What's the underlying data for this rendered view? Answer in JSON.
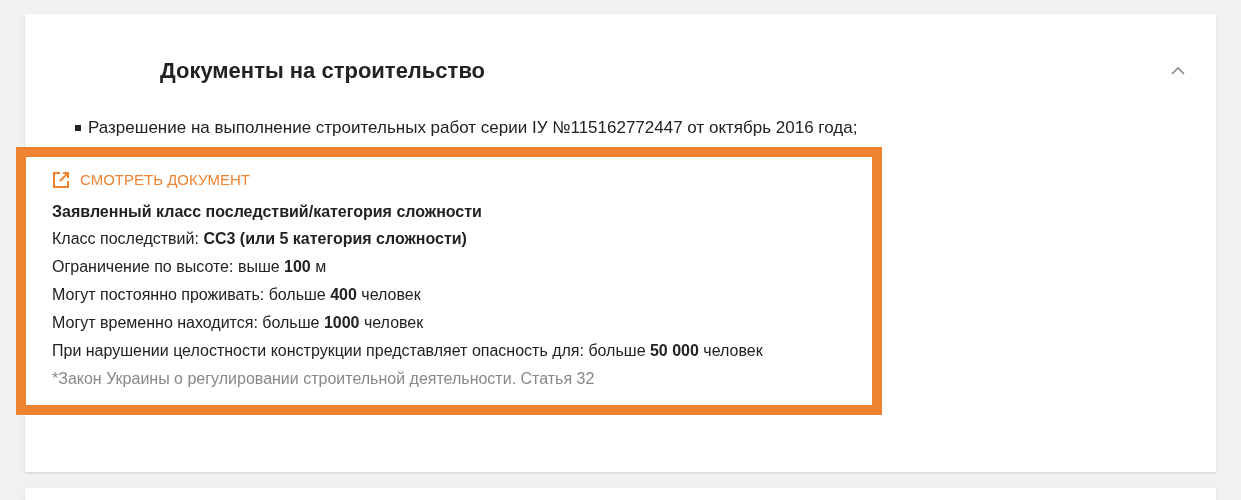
{
  "section": {
    "title": "Документы на строительство",
    "expanded": true
  },
  "items": [
    "Разрешение на выполнение строительных работ серии ІУ №115162772447 от октябрь 2016 года;"
  ],
  "details": {
    "link": "СМОТРЕТЬ ДОКУМЕНТ",
    "heading": "Заявленный класс последствий/категория сложности",
    "lines": [
      "Класс последствий: **СС3 (или 5 категория сложности)**",
      "Ограничение по высоте: выше **100** м",
      "Могут постоянно проживать: больше **400** человек",
      "Могут временно находится: больше **1000** человек",
      "При нарушении целостности конструкции представляет опасность для: больше **50 000** человек"
    ],
    "note": "*Закон Украины о регулировании строительной деятельности. Статья 32"
  }
}
